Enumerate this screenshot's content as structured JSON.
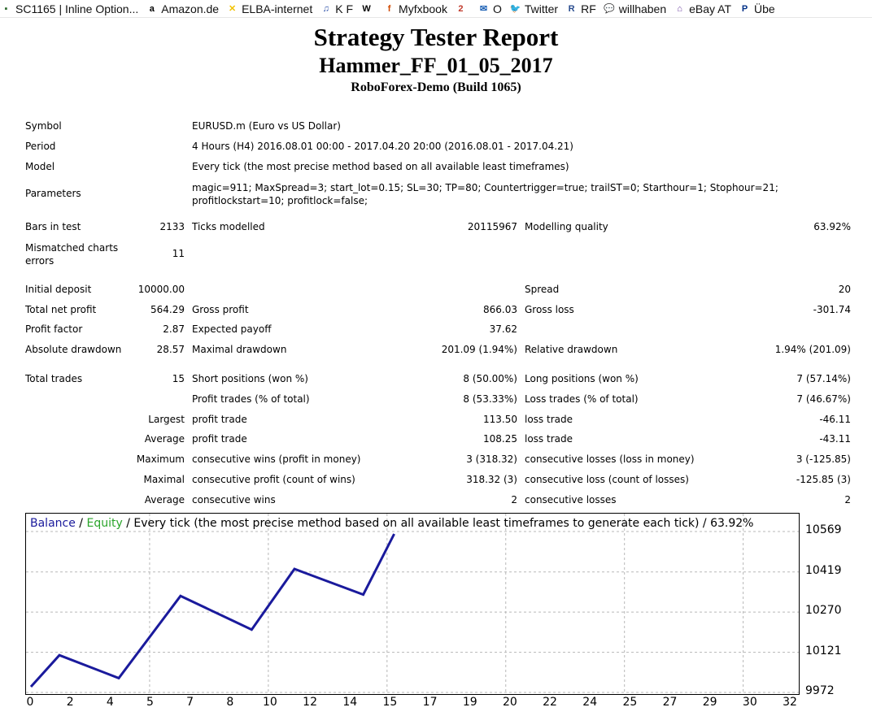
{
  "bookmarks": [
    {
      "label": "SC1165 | Inline Option...",
      "icon": "document-icon",
      "color": "#2e6b2e",
      "glyph": "▪"
    },
    {
      "label": "Amazon.de",
      "icon": "amazon-icon",
      "color": "#000000",
      "glyph": "a"
    },
    {
      "label": "ELBA-internet",
      "icon": "elba-icon",
      "color": "#f2c200",
      "glyph": "✕"
    },
    {
      "label": "K F",
      "icon": "music-note-icon",
      "color": "#2b4fa8",
      "glyph": "♫"
    },
    {
      "label": "",
      "icon": "wikipedia-icon",
      "color": "#000000",
      "glyph": "W"
    },
    {
      "label": "Myfxbook",
      "icon": "myfxbook-icon",
      "color": "#d04a02",
      "glyph": "f"
    },
    {
      "label": "",
      "icon": "calendar-icon",
      "color": "#c0392b",
      "glyph": "2"
    },
    {
      "label": "O",
      "icon": "outlook-icon",
      "color": "#1a5fb4",
      "glyph": "✉"
    },
    {
      "label": "Twitter",
      "icon": "twitter-icon",
      "color": "#1da1f2",
      "glyph": "🐦"
    },
    {
      "label": "RF",
      "icon": "roboforex-icon",
      "color": "#2a4d8f",
      "glyph": "R"
    },
    {
      "label": "willhaben",
      "icon": "speech-bubble-icon",
      "color": "#1e90c8",
      "glyph": "💬"
    },
    {
      "label": "eBay AT",
      "icon": "shop-icon",
      "color": "#6b3fa0",
      "glyph": "⌂"
    },
    {
      "label": "Übe",
      "icon": "paypal-icon",
      "color": "#003087",
      "glyph": "P"
    }
  ],
  "report": {
    "title": "Strategy Tester Report",
    "subtitle": "Hammer_FF_01_05_2017",
    "build": "RoboForex-Demo (Build 1065)",
    "symbol": {
      "label": "Symbol",
      "value": "EURUSD.m (Euro vs US Dollar)"
    },
    "period": {
      "label": "Period",
      "value": "4 Hours (H4) 2016.08.01 00:00 - 2017.04.20 20:00 (2016.08.01 - 2017.04.21)"
    },
    "model": {
      "label": "Model",
      "value": "Every tick (the most precise method based on all available least timeframes)"
    },
    "parameters": {
      "label": "Parameters",
      "value": "magic=911; MaxSpread=3; start_lot=0.15; SL=30; TP=80; Countertrigger=true; trailST=0; Starthour=1; Stophour=21; profitlockstart=10; profitlock=false;"
    },
    "bars": {
      "label": "Bars in test",
      "value": "2133"
    },
    "ticks": {
      "label": "Ticks modelled",
      "value": "20115967"
    },
    "quality": {
      "label": "Modelling quality",
      "value": "63.92%"
    },
    "mismatched": {
      "label": "Mismatched charts errors",
      "value": "11"
    },
    "initial_deposit": {
      "label": "Initial deposit",
      "value": "10000.00"
    },
    "spread": {
      "label": "Spread",
      "value": "20"
    },
    "net_profit": {
      "label": "Total net profit",
      "value": "564.29"
    },
    "gross_profit": {
      "label": "Gross profit",
      "value": "866.03"
    },
    "gross_loss": {
      "label": "Gross loss",
      "value": "-301.74"
    },
    "profit_factor": {
      "label": "Profit factor",
      "value": "2.87"
    },
    "expected_payoff": {
      "label": "Expected payoff",
      "value": "37.62"
    },
    "abs_drawdown": {
      "label": "Absolute drawdown",
      "value": "28.57"
    },
    "max_drawdown": {
      "label": "Maximal drawdown",
      "value": "201.09 (1.94%)"
    },
    "rel_drawdown": {
      "label": "Relative drawdown",
      "value": "1.94% (201.09)"
    },
    "total_trades": {
      "label": "Total trades",
      "value": "15"
    },
    "short_pos": {
      "label": "Short positions (won %)",
      "value": "8 (50.00%)"
    },
    "long_pos": {
      "label": "Long positions (won %)",
      "value": "7 (57.14%)"
    },
    "profit_trades": {
      "label": "Profit trades (% of total)",
      "value": "8 (53.33%)"
    },
    "loss_trades": {
      "label": "Loss trades (% of total)",
      "value": "7 (46.67%)"
    },
    "largest": {
      "label": "Largest",
      "profit_label": "profit trade",
      "profit_value": "113.50",
      "loss_label": "loss trade",
      "loss_value": "-46.11"
    },
    "average": {
      "label": "Average",
      "profit_label": "profit trade",
      "profit_value": "108.25",
      "loss_label": "loss trade",
      "loss_value": "-43.11"
    },
    "maximum": {
      "label": "Maximum",
      "profit_label": "consecutive wins (profit in money)",
      "profit_value": "3 (318.32)",
      "loss_label": "consecutive losses (loss in money)",
      "loss_value": "3 (-125.85)"
    },
    "maximal": {
      "label": "Maximal",
      "profit_label": "consecutive profit (count of wins)",
      "profit_value": "318.32 (3)",
      "loss_label": "consecutive loss (count of losses)",
      "loss_value": "-125.85 (3)"
    },
    "average2": {
      "label": "Average",
      "profit_label": "consecutive wins",
      "profit_value": "2",
      "loss_label": "consecutive losses",
      "loss_value": "2"
    }
  },
  "chart": {
    "legend_balance": "Balance",
    "legend_sep1": " / ",
    "legend_equity": "Equity",
    "legend_rest": " / Every tick (the most precise method based on all available least timeframes to generate each tick) / 63.92%",
    "balance_color": "#1a1a9c",
    "equity_color": "#2aa52a"
  },
  "chart_data": {
    "type": "line",
    "x": [
      0,
      1.2,
      3.7,
      6.3,
      9.3,
      11.1,
      14.0,
      15.3
    ],
    "series": [
      {
        "name": "Balance",
        "values": [
          9993,
          10110,
          10025,
          10330,
          10205,
          10430,
          10335,
          10560
        ]
      }
    ],
    "xticks": [
      0,
      2,
      4,
      5,
      7,
      8,
      10,
      12,
      14,
      15,
      17,
      19,
      20,
      22,
      24,
      25,
      27,
      29,
      30,
      32
    ],
    "yticks": [
      9972,
      10121,
      10270,
      10419,
      10569
    ],
    "ylim": [
      9972,
      10569
    ],
    "xlim": [
      0,
      32
    ],
    "grid": true
  }
}
